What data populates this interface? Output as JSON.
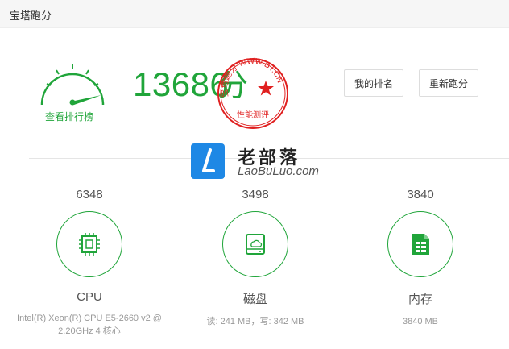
{
  "window": {
    "title": "宝塔跑分"
  },
  "summary": {
    "total_score": "13686",
    "unit": "分",
    "leaderboard_link": "查看排行榜",
    "stamp": {
      "ring_text": "宝塔跑分 WWW.BT.CN",
      "bottom_text": "性能测评"
    }
  },
  "actions": {
    "my_rank": "我的排名",
    "retest": "重新跑分"
  },
  "watermark": {
    "title": "老部落",
    "subtitle": "LaoBuLuo.com"
  },
  "metrics": [
    {
      "score": "6348",
      "name": "CPU",
      "icon": "cpu-icon",
      "desc": "Intel(R) Xeon(R) CPU E5-2660 v2 @ 2.20GHz 4 核心"
    },
    {
      "score": "3498",
      "name": "磁盘",
      "icon": "disk-icon",
      "desc": "读: 241 MB，写: 342 MB"
    },
    {
      "score": "3840",
      "name": "内存",
      "icon": "memory-icon",
      "desc": "3840 MB"
    }
  ],
  "colors": {
    "accent": "#20a53a",
    "stamp": "#e02020",
    "watermark": "#1e88e5"
  }
}
